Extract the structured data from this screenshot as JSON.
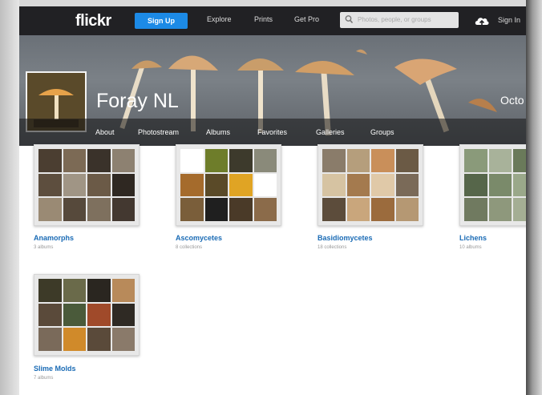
{
  "nav": {
    "logo": "flickr",
    "signup_label": "Sign Up",
    "links": [
      "Explore",
      "Prints",
      "Get Pro"
    ],
    "search_placeholder": "Photos, people, or groups",
    "signin_label": "Sign In"
  },
  "profile": {
    "name": "Foray NL",
    "joined_partial": "Octo"
  },
  "subnav": [
    "About",
    "Photostream",
    "Albums",
    "Favorites",
    "Galleries",
    "Groups"
  ],
  "collections": [
    {
      "title": "Anamorphs",
      "count": "3 albums",
      "palette": [
        "#4b3e31",
        "#7c6a55",
        "#3a322a",
        "#8d8171",
        "#5d4e3e",
        "#a09585",
        "#6b5a47",
        "#2f2822",
        "#9a8a74",
        "#56493b",
        "#7e705e",
        "#433830"
      ]
    },
    {
      "title": "Ascomycetes",
      "count": "8 collections",
      "palette": [
        "#ffffff",
        "#6e7d2a",
        "#3d3a2c",
        "#8a8a7a",
        "#a56b2c",
        "#5a4a28",
        "#e0a424",
        "#ffffff",
        "#7a5e3a",
        "#1f1f1f",
        "#4a3a28",
        "#8b6b4a"
      ]
    },
    {
      "title": "Basidiomycetes",
      "count": "18 collections",
      "palette": [
        "#8a7c6a",
        "#b59e7c",
        "#c98f5a",
        "#6b5a45",
        "#d6c3a2",
        "#a47a4e",
        "#e0c9a8",
        "#7a6a58",
        "#5c4c3b",
        "#c9a67c",
        "#9b6b3d",
        "#b59873"
      ]
    },
    {
      "title": "Lichens",
      "count": "10 albums",
      "palette": [
        "#8a9a7a",
        "#a8b29a",
        "#6a7a5a",
        "#c0c8b0",
        "#56664a",
        "#7a8a6a",
        "#9aa88a",
        "#bfc6b4",
        "#707a60",
        "#8e987c",
        "#a4ae94",
        "#5e6a50"
      ]
    },
    {
      "title": "Slime Molds",
      "count": "7 albums",
      "palette": [
        "#3d3a28",
        "#6a6a4a",
        "#2a2620",
        "#b88a5a",
        "#5a4a3a",
        "#4a5a3a",
        "#a04a2a",
        "#2f2a24",
        "#7a6a5a",
        "#d08a2a",
        "#5a4a3a",
        "#8a7a6a"
      ]
    }
  ]
}
